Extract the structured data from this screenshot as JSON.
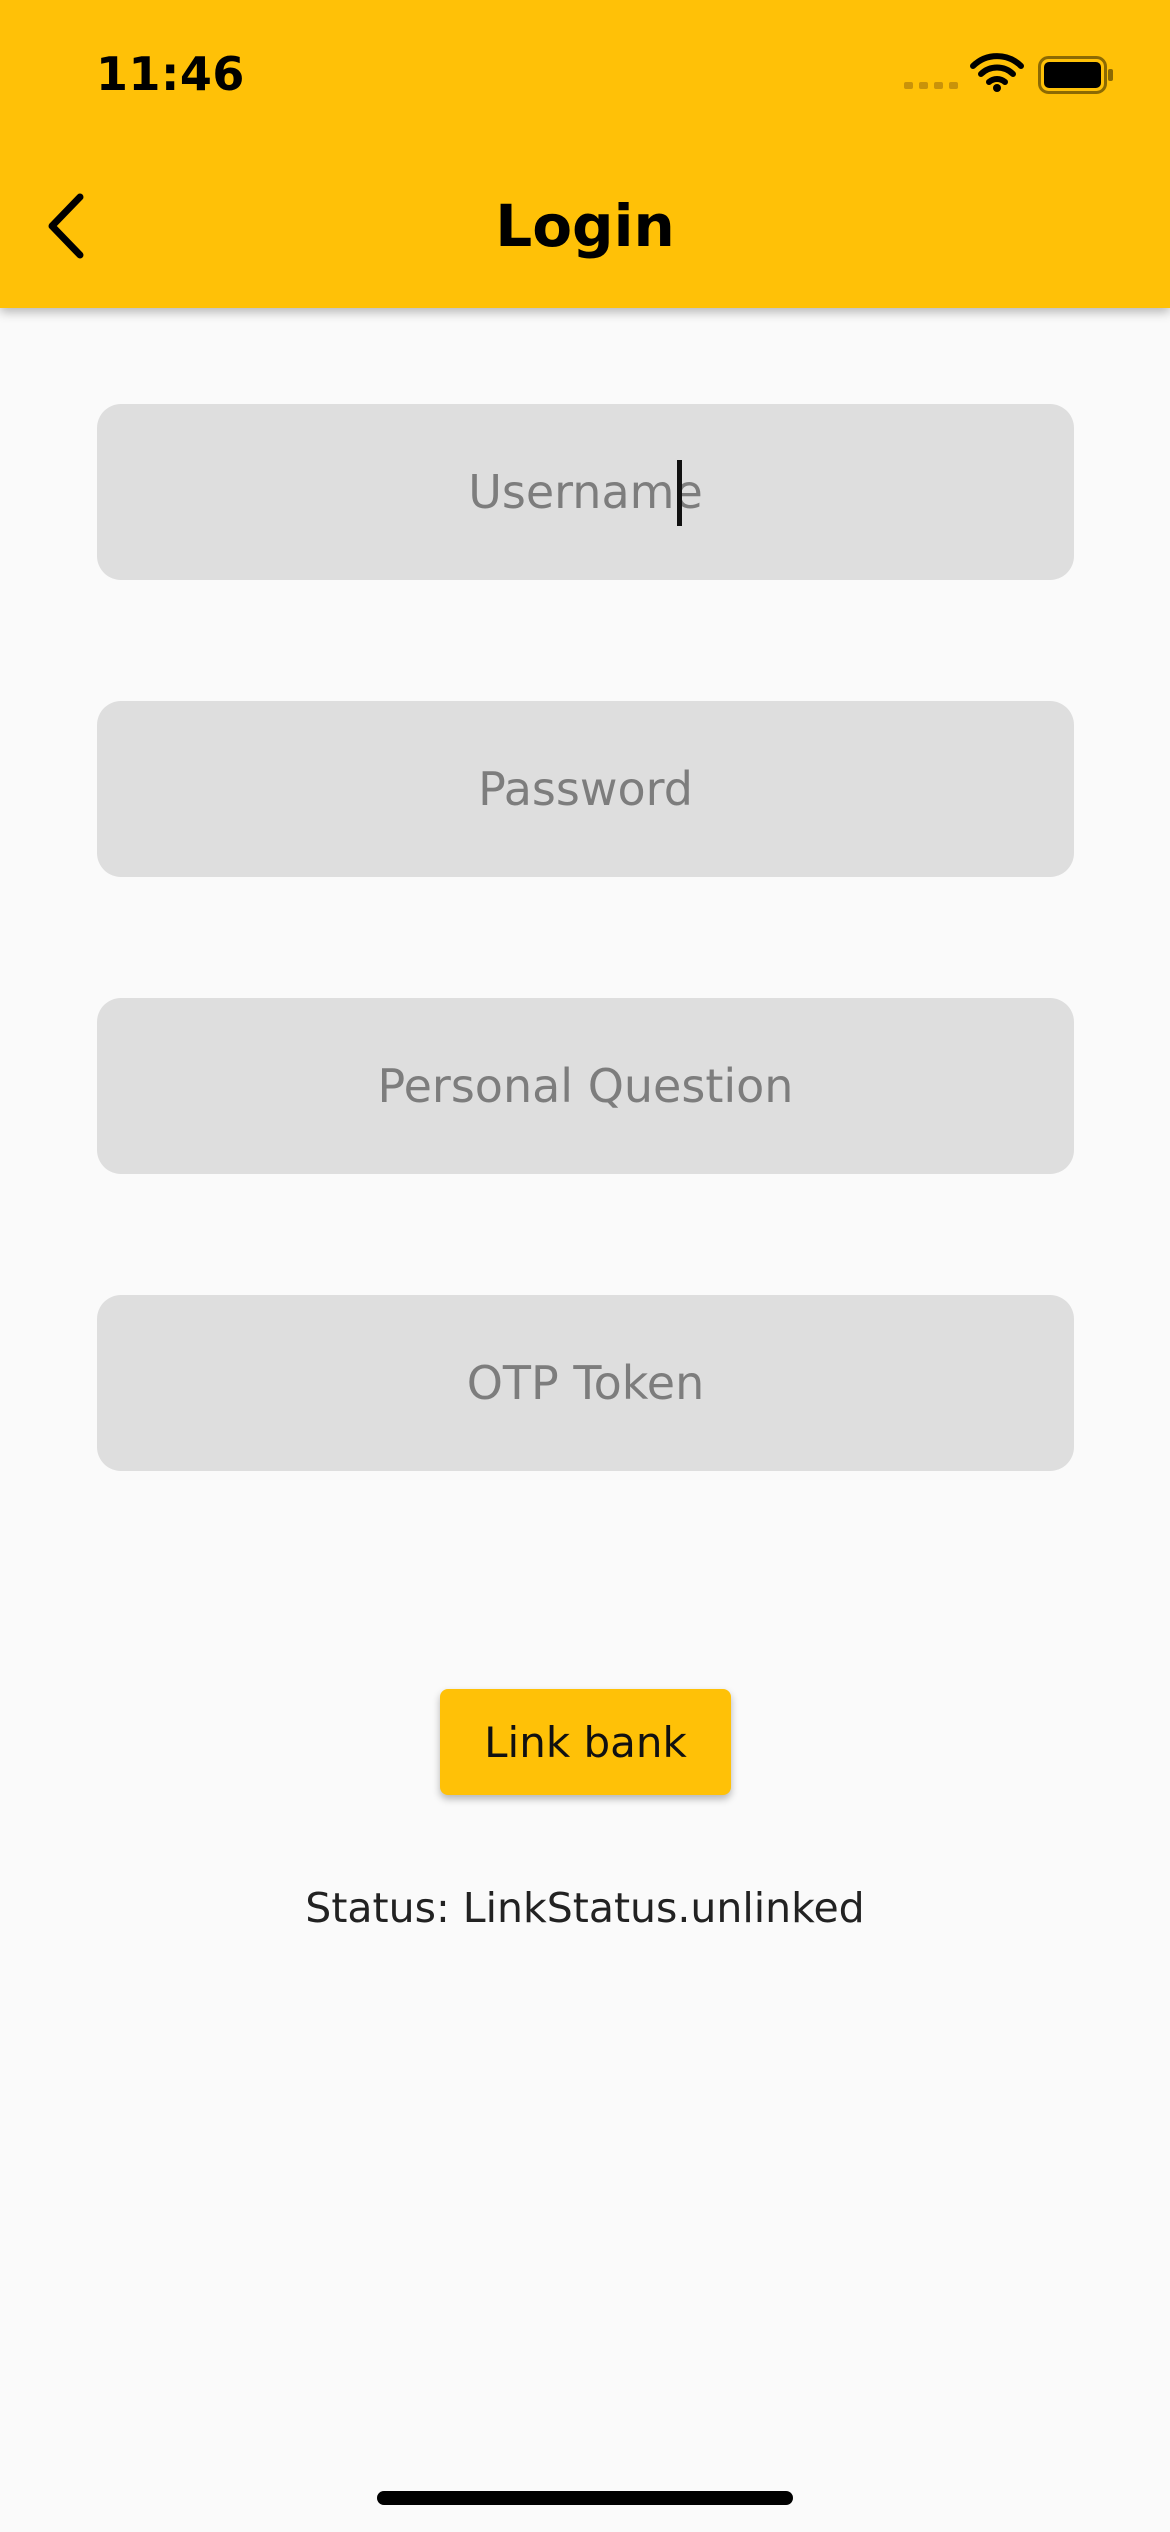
{
  "status_bar": {
    "time": "11:46",
    "signal_icon": "cellular-signal-icon",
    "wifi_icon": "wifi-icon",
    "battery_icon": "battery-icon"
  },
  "app_bar": {
    "title": "Login",
    "back_icon": "chevron-left-icon",
    "background_color": "#ffc107"
  },
  "form": {
    "username": {
      "placeholder": "Username",
      "value": ""
    },
    "password": {
      "placeholder": "Password",
      "value": ""
    },
    "personal_question": {
      "placeholder": "Personal Question",
      "value": ""
    },
    "otp_token": {
      "placeholder": "OTP Token",
      "value": ""
    }
  },
  "actions": {
    "link_label": "Link bank"
  },
  "status": {
    "text": "Status: LinkStatus.unlinked"
  },
  "colors": {
    "accent": "#ffc107",
    "field_background": "#dedede",
    "page_background": "#fafafa"
  }
}
